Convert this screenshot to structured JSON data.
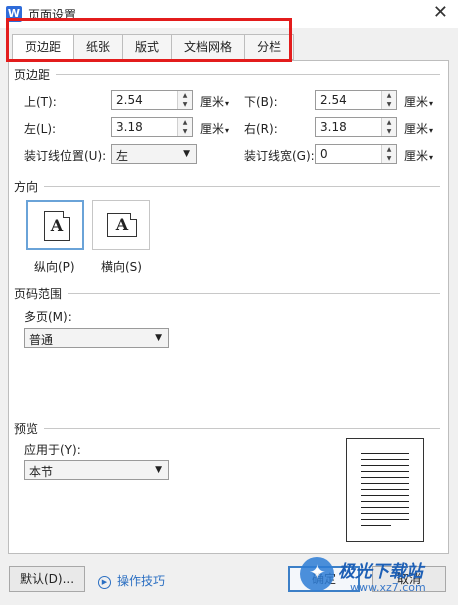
{
  "window": {
    "title": "页面设置",
    "app_icon_letter": "W",
    "close_symbol": "✕"
  },
  "tabs": [
    {
      "label": "页边距",
      "active": true
    },
    {
      "label": "纸张",
      "active": false
    },
    {
      "label": "版式",
      "active": false
    },
    {
      "label": "文档网格",
      "active": false
    },
    {
      "label": "分栏",
      "active": false
    }
  ],
  "margins": {
    "section_label": "页边距",
    "top": {
      "label": "上(T):",
      "value": "2.54",
      "unit": "厘米"
    },
    "bottom": {
      "label": "下(B):",
      "value": "2.54",
      "unit": "厘米"
    },
    "left": {
      "label": "左(L):",
      "value": "3.18",
      "unit": "厘米"
    },
    "right": {
      "label": "右(R):",
      "value": "3.18",
      "unit": "厘米"
    },
    "gutter_position": {
      "label": "装订线位置(U):",
      "value": "左"
    },
    "gutter_width": {
      "label": "装订线宽(G):",
      "value": "0",
      "unit": "厘米"
    }
  },
  "orientation": {
    "section_label": "方向",
    "portrait": {
      "label": "纵向(P)",
      "glyph": "A",
      "selected": true
    },
    "landscape": {
      "label": "横向(S)",
      "glyph": "A",
      "selected": false
    }
  },
  "pages": {
    "section_label": "页码范围",
    "multiple_label": "多页(M):",
    "multiple_value": "普通"
  },
  "preview": {
    "section_label": "预览",
    "apply_to_label": "应用于(Y):",
    "apply_to_value": "本节"
  },
  "footer": {
    "default_button": "默认(D)...",
    "tips_link": "操作技巧",
    "ok_button": "确定",
    "cancel_button": "取消"
  },
  "watermark": {
    "brand": "极光下载站",
    "url": "www.xz7.com"
  },
  "colors": {
    "highlight_box": "#e31c1c",
    "accent": "#3c7fc7",
    "link": "#2b6fc2"
  }
}
